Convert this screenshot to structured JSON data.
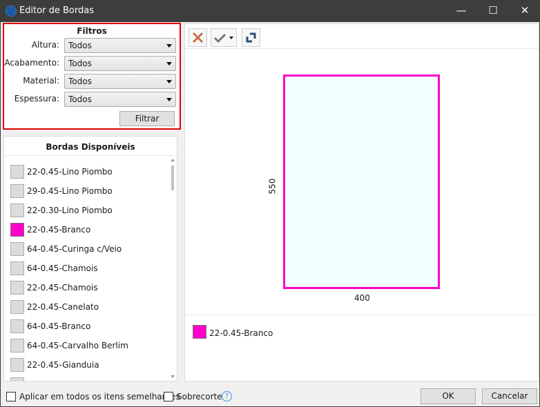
{
  "window": {
    "title": "Editor de Bordas",
    "minimize": "—",
    "maximize": "☐",
    "close": "✕"
  },
  "filters": {
    "title": "Filtros",
    "fields": [
      {
        "label": "Altura:",
        "value": "Todos"
      },
      {
        "label": "Acabamento:",
        "value": "Todos"
      },
      {
        "label": "Material:",
        "value": "Todos"
      },
      {
        "label": "Espessura:",
        "value": "Todos"
      }
    ],
    "button": "Filtrar"
  },
  "list": {
    "title": "Bordas Disponíveis",
    "items": [
      {
        "label": "22-0.45-Lino Piombo",
        "color": "#dcdcdc"
      },
      {
        "label": "29-0.45-Lino Piombo",
        "color": "#dcdcdc"
      },
      {
        "label": "22-0.30-Lino Piombo",
        "color": "#dcdcdc"
      },
      {
        "label": "22-0.45-Branco",
        "color": "#ff00cc"
      },
      {
        "label": "64-0.45-Curinga c/Veio",
        "color": "#dcdcdc"
      },
      {
        "label": "64-0.45-Chamois",
        "color": "#dcdcdc"
      },
      {
        "label": "22-0.45-Chamois",
        "color": "#dcdcdc"
      },
      {
        "label": "22-0.45-Canelato",
        "color": "#dcdcdc"
      },
      {
        "label": "64-0.45-Branco",
        "color": "#dcdcdc"
      },
      {
        "label": "64-0.45-Carvalho Berlim",
        "color": "#dcdcdc"
      },
      {
        "label": "22-0.45-Gianduia",
        "color": "#dcdcdc"
      }
    ]
  },
  "preview": {
    "height": "550",
    "width": "400",
    "border_color": "#ff00cc",
    "fill_color": "#f0ffff"
  },
  "legend": {
    "label": "22-0.45-Branco",
    "color": "#ff00cc"
  },
  "footer": {
    "apply_similar": "Aplicar em todos os itens semelhantes",
    "apply_similar_checked": false,
    "overcut": "Sobrecorte",
    "overcut_checked": false,
    "help": "?",
    "ok": "OK",
    "cancel": "Cancelar"
  }
}
